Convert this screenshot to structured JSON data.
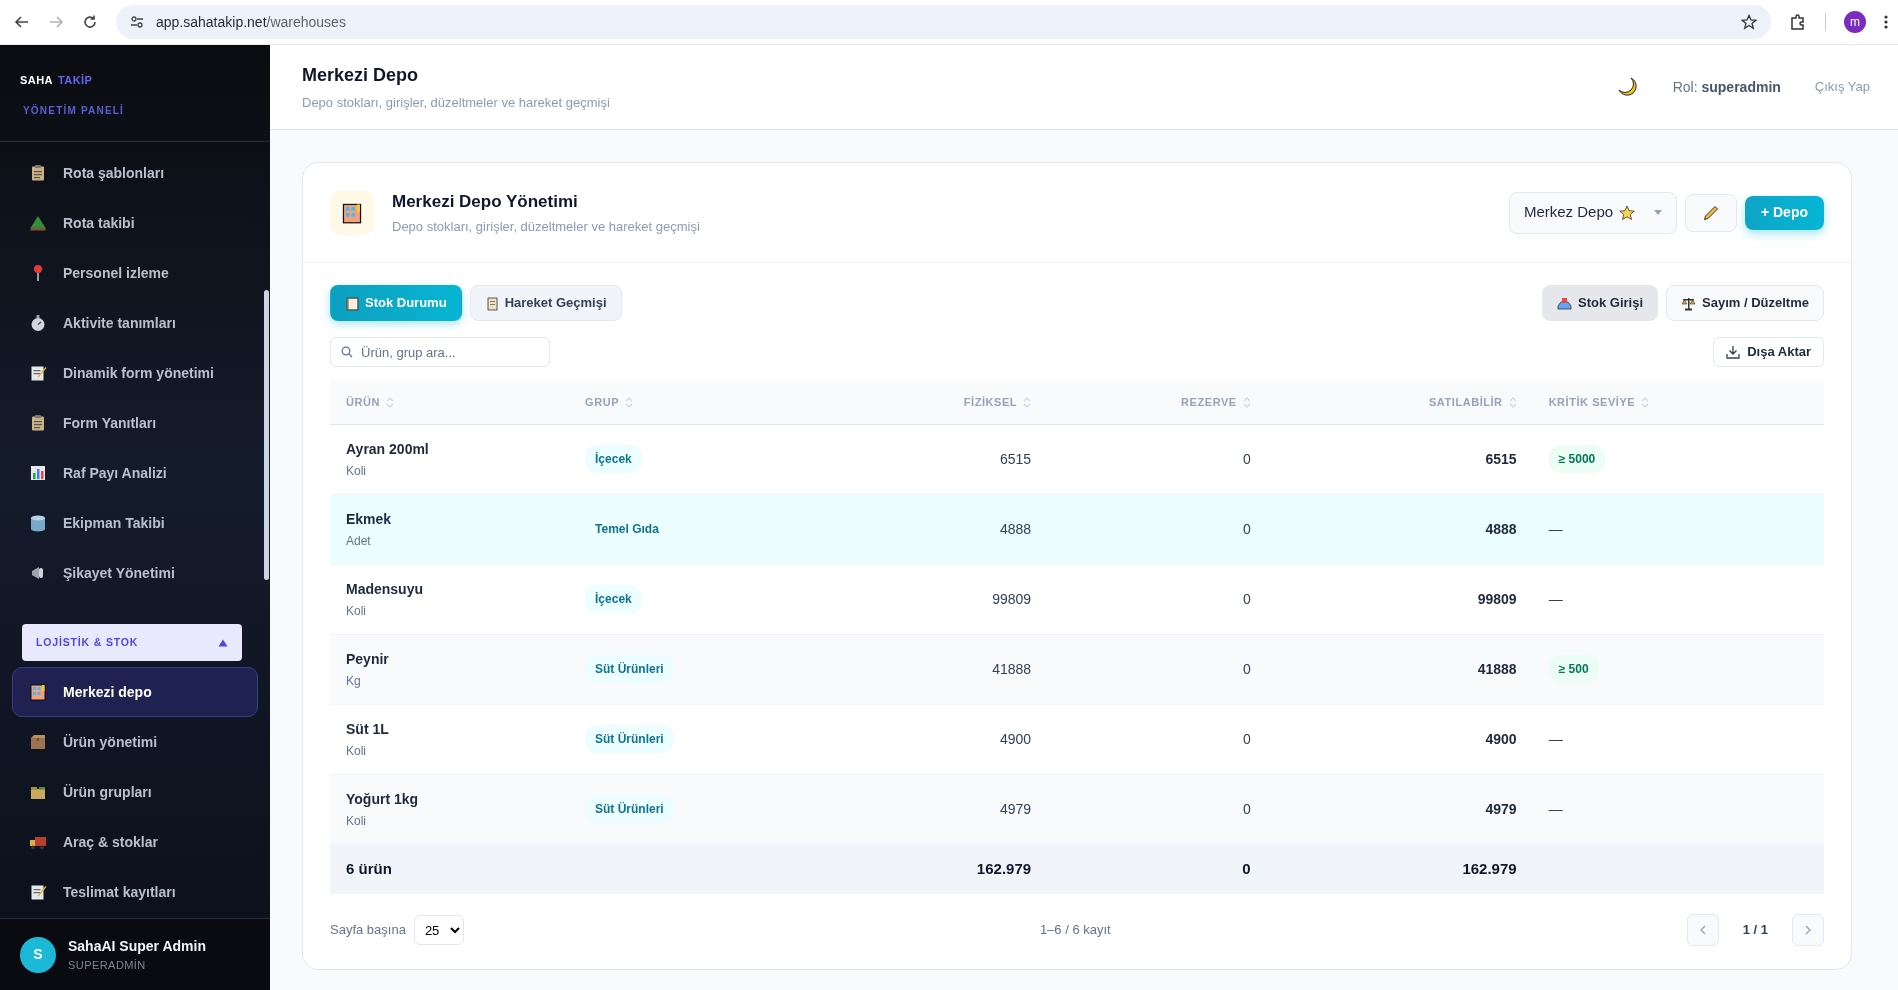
{
  "browser": {
    "url_host": "app.sahatakip.net",
    "url_path": "/warehouses",
    "profile": "m"
  },
  "sidebar": {
    "brand_first": "SAHA",
    "brand_second": "TAKİP",
    "subtitle": "YÖNETİM PANELİ",
    "items": [
      {
        "label": "Rota şablonları",
        "selected": false
      },
      {
        "label": "Rota takibi",
        "selected": false
      },
      {
        "label": "Personel izleme",
        "selected": false
      },
      {
        "label": "Aktivite tanımları",
        "selected": false
      },
      {
        "label": "Dinamik form yönetimi",
        "selected": false
      },
      {
        "label": "Form Yanıtları",
        "selected": false
      },
      {
        "label": "Raf Payı Analizi",
        "selected": false
      },
      {
        "label": "Ekipman Takibi",
        "selected": false
      },
      {
        "label": "Şikayet Yönetimi",
        "selected": false
      }
    ],
    "section": {
      "label": "LOJİSTİK & STOK",
      "expanded": true
    },
    "section_items": [
      {
        "label": "Merkezi depo",
        "selected": true
      },
      {
        "label": "Ürün yönetimi",
        "selected": false
      },
      {
        "label": "Ürün grupları",
        "selected": false
      },
      {
        "label": "Araç & stoklar",
        "selected": false
      },
      {
        "label": "Teslimat kayıtları",
        "selected": false
      }
    ],
    "user": {
      "initial": "S",
      "name": "SahaAI Super Admin",
      "role": "SUPERADMİN"
    }
  },
  "header": {
    "title": "Merkezi Depo",
    "subtitle": "Depo stokları, girişler, düzeltmeler ve hareket geçmişi",
    "role_label": "Rol:",
    "role": "superadmin",
    "logout": "Çıkış Yap"
  },
  "card": {
    "title": "Merkezi Depo Yönetimi",
    "subtitle": "Depo stokları, girişler, düzeltmeler ve hareket geçmişi",
    "warehouse": "Merkez Depo",
    "starred": true,
    "add_button": "+ Depo"
  },
  "tabs": [
    {
      "label": "Stok Durumu",
      "selected": true
    },
    {
      "label": "Hareket Geçmişi",
      "selected": false
    }
  ],
  "actions": [
    {
      "label": "Stok Girişi",
      "highlighted": true
    },
    {
      "label": "Sayım / Düzeltme",
      "highlighted": false
    }
  ],
  "search": {
    "placeholder": "Ürün, grup ara..."
  },
  "export_button": "Dışa Aktar",
  "table": {
    "columns": [
      "ÜRÜN",
      "GRUP",
      "FİZİKSEL",
      "REZERVE",
      "SATILABİLİR",
      "KRİTİK SEVİYE"
    ],
    "rows": [
      {
        "name": "Ayran 200ml",
        "unit": "Koli",
        "group": "İçecek",
        "physical": "6515",
        "reserved": "0",
        "available": "6515",
        "critical": {
          "kind": "badge",
          "text": "≥ 5000"
        },
        "highlighted": false
      },
      {
        "name": "Ekmek",
        "unit": "Adet",
        "group": "Temel Gıda",
        "physical": "4888",
        "reserved": "0",
        "available": "4888",
        "critical": {
          "kind": "dash",
          "text": "—"
        },
        "highlighted": true
      },
      {
        "name": "Madensuyu",
        "unit": "Koli",
        "group": "İçecek",
        "physical": "99809",
        "reserved": "0",
        "available": "99809",
        "critical": {
          "kind": "dash",
          "text": "—"
        },
        "highlighted": false
      },
      {
        "name": "Peynir",
        "unit": "Kg",
        "group": "Süt Ürünleri",
        "physical": "41888",
        "reserved": "0",
        "available": "41888",
        "critical": {
          "kind": "badge",
          "text": "≥ 500"
        },
        "highlighted": false
      },
      {
        "name": "Süt 1L",
        "unit": "Koli",
        "group": "Süt Ürünleri",
        "physical": "4900",
        "reserved": "0",
        "available": "4900",
        "critical": {
          "kind": "dash",
          "text": "—"
        },
        "highlighted": false
      },
      {
        "name": "Yoğurt 1kg",
        "unit": "Koli",
        "group": "Süt Ürünleri",
        "physical": "4979",
        "reserved": "0",
        "available": "4979",
        "critical": {
          "kind": "dash",
          "text": "—"
        },
        "highlighted": false
      }
    ],
    "totals": {
      "label": "6 ürün",
      "physical": "162.979",
      "reserved": "0",
      "available": "162.979"
    }
  },
  "pagination": {
    "per_page_label": "Sayfa başına",
    "per_page": "25",
    "range": "1–6 / 6 kayıt",
    "page": "1 / 1"
  }
}
